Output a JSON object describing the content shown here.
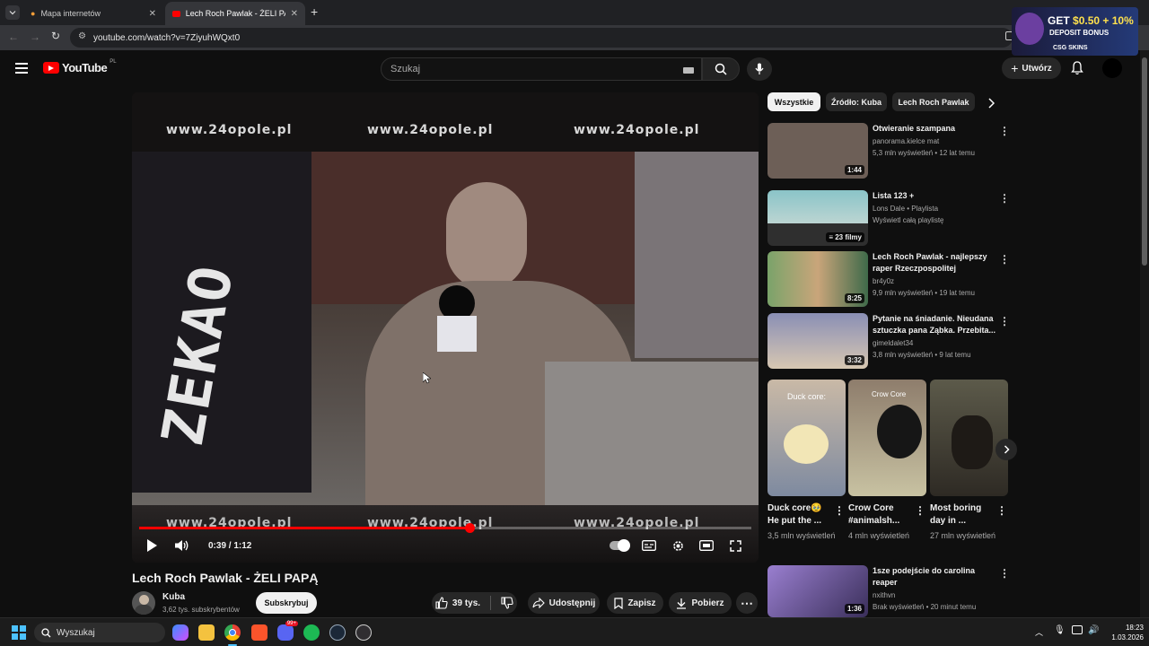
{
  "browser": {
    "tabs": [
      {
        "label": "Mapa internetów"
      },
      {
        "label": "Lech Roch Pawlak - ŻELI PAPĄ"
      }
    ],
    "url": "youtube.com/watch?v=7ZiyuhWQxt0"
  },
  "ad": {
    "line1": "GET",
    "amount": "$0.50",
    "bonus": "+ 10%",
    "deposit": "DEPOSIT BONUS",
    "brand": "CSG SKINS"
  },
  "youtube": {
    "logo": "YouTube",
    "region": "PL",
    "search_placeholder": "Szukaj",
    "create_label": "Utwórz"
  },
  "player": {
    "watermark": "www.24opole.pl",
    "frame_text": "ZEKAO",
    "time": "0:39 / 1:12",
    "progress": 0.54
  },
  "video": {
    "title": "Lech Roch Pawlak - ŻELI PAPĄ",
    "channel": "Kuba",
    "subscribers": "3,62 tys. subskrybentów",
    "subscribe_label": "Subskrybuj",
    "likes": "39 tys.",
    "share_label": "Udostępnij",
    "save_label": "Zapisz",
    "download_label": "Pobierz"
  },
  "chips": [
    "Wszystkie",
    "Źródło: Kuba",
    "Lech Roch Pawlak"
  ],
  "recommendations": [
    {
      "title": "Otwieranie szampana",
      "channel": "panorama.kielce mat",
      "stats": "5,3 mln wyświetleń • 12 lat temu",
      "duration": "1:44",
      "thumb": "#6d5f57"
    },
    {
      "title": "Lista 123 +",
      "channel": "Lons Dale • Playlista",
      "stats": "Wyświetl całą playlistę",
      "duration": "23 filmy",
      "thumb": "#3d7f8a"
    },
    {
      "title": "Lech Roch Pawlak - najlepszy raper Rzeczpospolitej",
      "channel": "br4y0z",
      "stats": "9,9 mln wyświetleń • 19 lat temu",
      "duration": "8:25",
      "thumb": "#7aa36a"
    },
    {
      "title": "Pytanie na śniadanie. Nieudana sztuczka pana Ząbka. Przebita...",
      "channel": "gimeldalet34",
      "stats": "3,8 mln wyświetleń • 9 lat temu",
      "duration": "3:32",
      "thumb": "#8a8fb5"
    }
  ],
  "shorts": [
    {
      "title": "Duck core🥹 He put the ...",
      "views": "3,5 mln wyświetleń",
      "overlay": "Duck core:",
      "thumb": "#c9b9a6"
    },
    {
      "title": "Crow Core #animalsh...",
      "views": "4 mln wyświetleń",
      "overlay": "Crow Core",
      "thumb": "#8e7d6c"
    },
    {
      "title": "Most boring day in ...",
      "views": "27 mln wyświetleń",
      "overlay": "",
      "thumb": "#3f3a33"
    }
  ],
  "bottom_rec": {
    "title": "1sze podejście do carolina reaper",
    "channel": "nxithvn",
    "stats": "Brak wyświetleń • 20 minut temu",
    "duration": "1:36",
    "thumb": "#5b4c7a"
  },
  "taskbar": {
    "search_placeholder": "Wyszukaj",
    "time": "18:23",
    "date": "1.03.2026",
    "discord_badge": "99+"
  }
}
